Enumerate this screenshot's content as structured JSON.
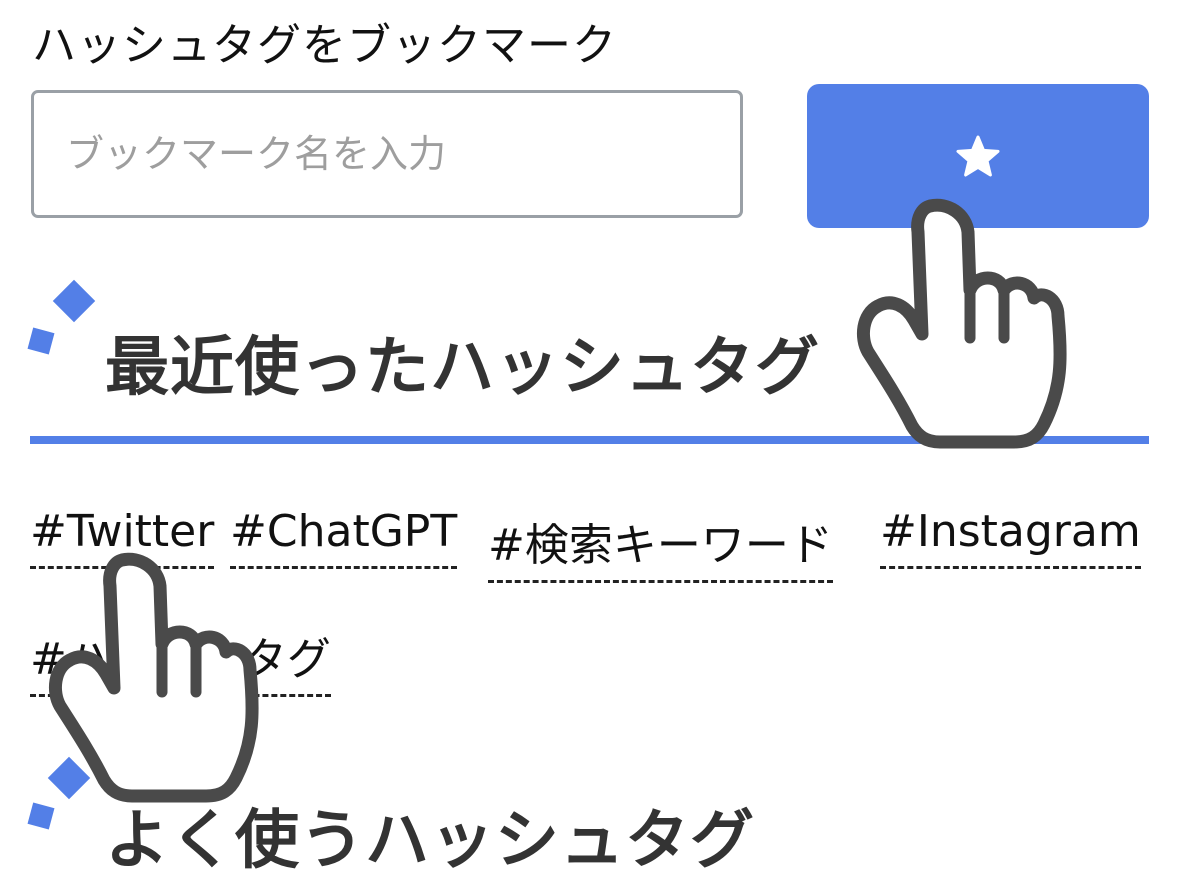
{
  "bookmark": {
    "title": "ハッシュタグをブックマーク",
    "input_placeholder": "ブックマーク名を入力",
    "input_value": "",
    "button_icon": "star-icon"
  },
  "recent": {
    "title": "最近使ったハッシュタグ",
    "tags": [
      {
        "label": "#Twitter"
      },
      {
        "label": "#ChatGPT"
      },
      {
        "label": "#検索キーワード"
      },
      {
        "label": "#Instagram"
      },
      {
        "label": "#ハッシュタグ"
      }
    ]
  },
  "frequent": {
    "title": "よく使うハッシュタグ"
  },
  "colors": {
    "accent": "#537fe7",
    "title_text": "#333333",
    "input_border": "#9aa0a6",
    "cursor": "#4a4a4a"
  },
  "icons": [
    "star-icon",
    "pointer-hand-icon"
  ]
}
